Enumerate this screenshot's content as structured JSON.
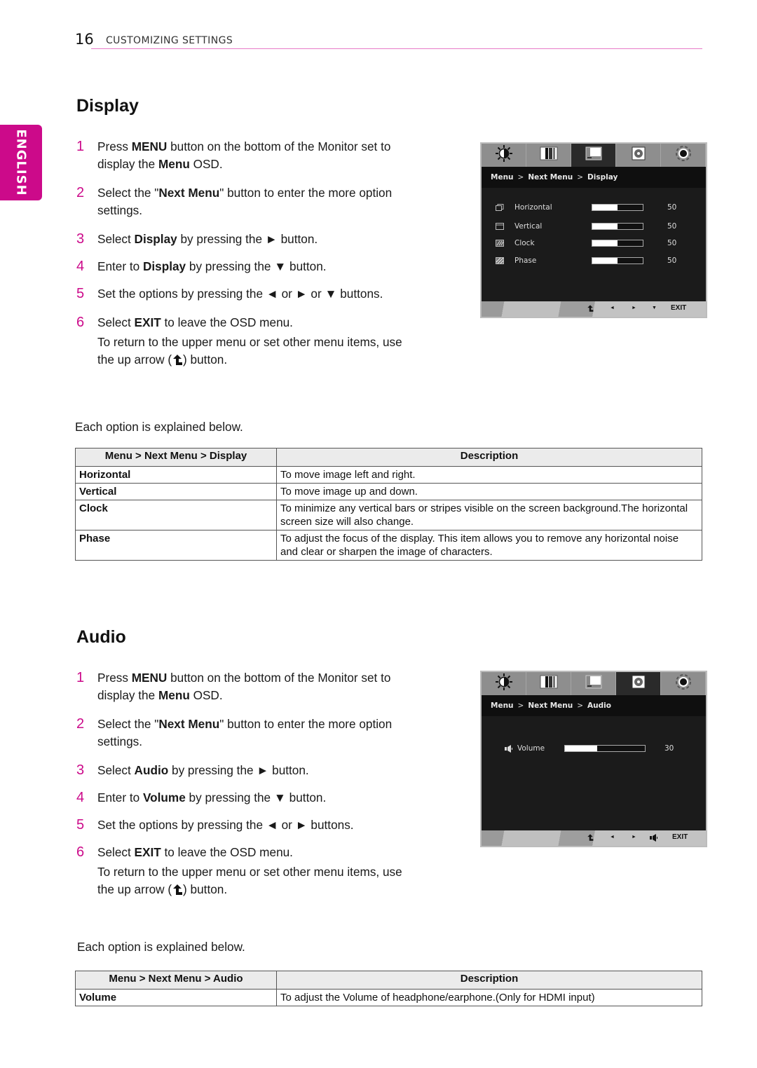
{
  "header": {
    "page_number": "16",
    "chapter": "CUSTOMIZING SETTINGS",
    "language_tab": "ENGLISH"
  },
  "colors": {
    "accent": "#cc0a8a",
    "rule": "#e87cc8"
  },
  "display": {
    "title": "Display",
    "steps": [
      {
        "num": "1",
        "parts": [
          "Press ",
          "MENU",
          " button on the bottom of the Monitor set to display the ",
          "Menu",
          " OSD."
        ]
      },
      {
        "num": "2",
        "parts": [
          "Select the \"",
          "Next Menu",
          "\" button to enter the more option settings."
        ]
      },
      {
        "num": "3",
        "parts": [
          "Select ",
          "Display",
          " by pressing the ► button."
        ]
      },
      {
        "num": "4",
        "parts": [
          "Enter to ",
          "Display",
          " by pressing the ▼ button."
        ]
      },
      {
        "num": "5",
        "parts": [
          "Set the options by pressing the ◄ or ► or ▼ buttons."
        ]
      },
      {
        "num": "6",
        "parts": [
          "Select ",
          "EXIT",
          " to leave the OSD menu."
        ]
      }
    ],
    "return_note_pre": "To return to the upper menu or set other menu items, use the up arrow (",
    "return_note_post": ") button.",
    "explain": "Each option is explained below.",
    "table": {
      "headers": [
        "Menu > Next Menu > Display",
        "Description"
      ],
      "rows": [
        {
          "key": "Horizontal",
          "desc": "To move image left and right."
        },
        {
          "key": "Vertical",
          "desc": "To move image up and down."
        },
        {
          "key": "Clock",
          "desc": "To minimize any vertical bars or stripes visible on the screen background.The horizontal screen size will also change."
        },
        {
          "key": "Phase",
          "desc": "To adjust the focus of the display. This item allows you to remove any horizontal noise and clear or sharpen the image of characters."
        }
      ]
    },
    "osd": {
      "tabs": [
        "brightness-icon",
        "color-bars-icon",
        "display-icon",
        "audio-icon",
        "settings-gear-icon"
      ],
      "active_tab": 2,
      "crumb": [
        "Menu",
        "Next Menu",
        "Display"
      ],
      "items": [
        {
          "label": "Horizontal",
          "value": "50",
          "fraction": 0.5
        },
        {
          "label": "Vertical",
          "value": "50",
          "fraction": 0.5
        },
        {
          "label": "Clock",
          "value": "50",
          "fraction": 0.5
        },
        {
          "label": "Phase",
          "value": "50",
          "fraction": 0.5
        }
      ],
      "footer": {
        "up": "up-arrow-icon",
        "left": "◄",
        "right": "►",
        "down": "▼",
        "exit": "EXIT"
      }
    }
  },
  "audio": {
    "title": "Audio",
    "steps": [
      {
        "num": "1",
        "parts": [
          "Press ",
          "MENU",
          " button on the bottom of the Monitor set to display the ",
          "Menu",
          " OSD."
        ]
      },
      {
        "num": "2",
        "parts": [
          "Select the \"",
          "Next Menu",
          "\" button to enter the more option settings."
        ]
      },
      {
        "num": "3",
        "parts": [
          "Select ",
          "Audio",
          " by pressing the ► button."
        ]
      },
      {
        "num": "4",
        "parts": [
          "Enter to ",
          "Volume",
          " by pressing the ▼ button."
        ]
      },
      {
        "num": "5",
        "parts": [
          "Set the options by pressing the ◄ or ► buttons."
        ]
      },
      {
        "num": "6",
        "parts": [
          "Select ",
          "EXIT",
          " to leave the OSD menu."
        ]
      }
    ],
    "return_note_pre": "To return to the upper menu or set other menu items, use the up arrow (",
    "return_note_post": ") button.",
    "explain": "Each option is explained below.",
    "table": {
      "headers": [
        "Menu > Next Menu > Audio",
        "Description"
      ],
      "rows": [
        {
          "key": "Volume",
          "desc": "To adjust the Volume of headphone/earphone.(Only for HDMI input)"
        }
      ]
    },
    "osd": {
      "tabs": [
        "brightness-icon",
        "color-bars-icon",
        "display-icon",
        "audio-icon",
        "settings-gear-icon"
      ],
      "active_tab": 3,
      "crumb": [
        "Menu",
        "Next Menu",
        "Audio"
      ],
      "items": [
        {
          "label": "Volume",
          "value": "30",
          "fraction": 0.3
        }
      ],
      "footer": {
        "up": "up-arrow-icon",
        "left": "◄",
        "right": "►",
        "volume": "speaker-icon",
        "exit": "EXIT"
      }
    }
  }
}
